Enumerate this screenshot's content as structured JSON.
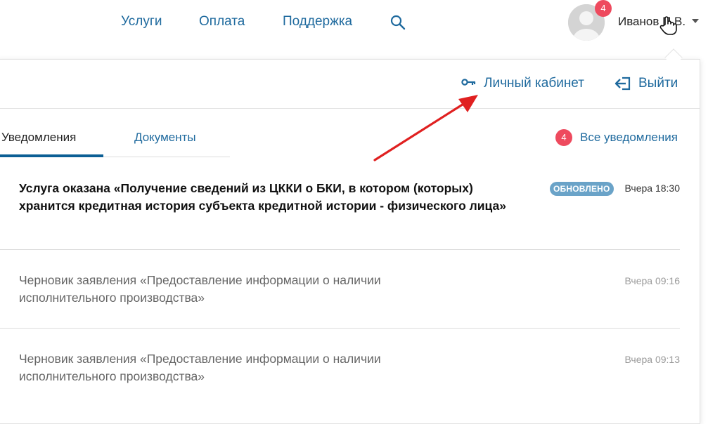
{
  "header": {
    "nav": [
      {
        "label": "Услуги"
      },
      {
        "label": "Оплата"
      },
      {
        "label": "Поддержка"
      }
    ],
    "search_icon": "search-icon",
    "avatar_badge": "4",
    "user_name": "Иванов П.В."
  },
  "dropdown": {
    "cabinet_label": "Личный кабинет",
    "cabinet_icon": "key-icon",
    "logout_label": "Выйти",
    "logout_icon": "logout-icon"
  },
  "tabs": [
    {
      "label": "Уведомления",
      "active": true
    },
    {
      "label": "Документы",
      "active": false
    }
  ],
  "all_notifications": {
    "badge": "4",
    "label": "Все уведомления"
  },
  "notifications": [
    {
      "text": "Услуга оказана «Получение сведений из ЦККИ о БКИ, в котором (которых) хранится кредитная история субъекта кредитной истории - физического лица»",
      "badge": "ОБНОВЛЕНО",
      "time": "Вчера 18:30",
      "unread": true
    },
    {
      "text": "Черновик заявления «Предоставление информации о наличии исполнительного производства»",
      "time": "Вчера 09:16",
      "unread": false
    },
    {
      "text": "Черновик заявления «Предоставление информации о наличии исполнительного производства»",
      "time": "Вчера 09:13",
      "unread": false
    }
  ],
  "colors": {
    "link": "#1f6a9e",
    "badge_red": "#ee4a5e",
    "badge_updated": "#6aa3c8",
    "tab_active": "#0c5f95",
    "annotation_arrow": "#e02020"
  }
}
